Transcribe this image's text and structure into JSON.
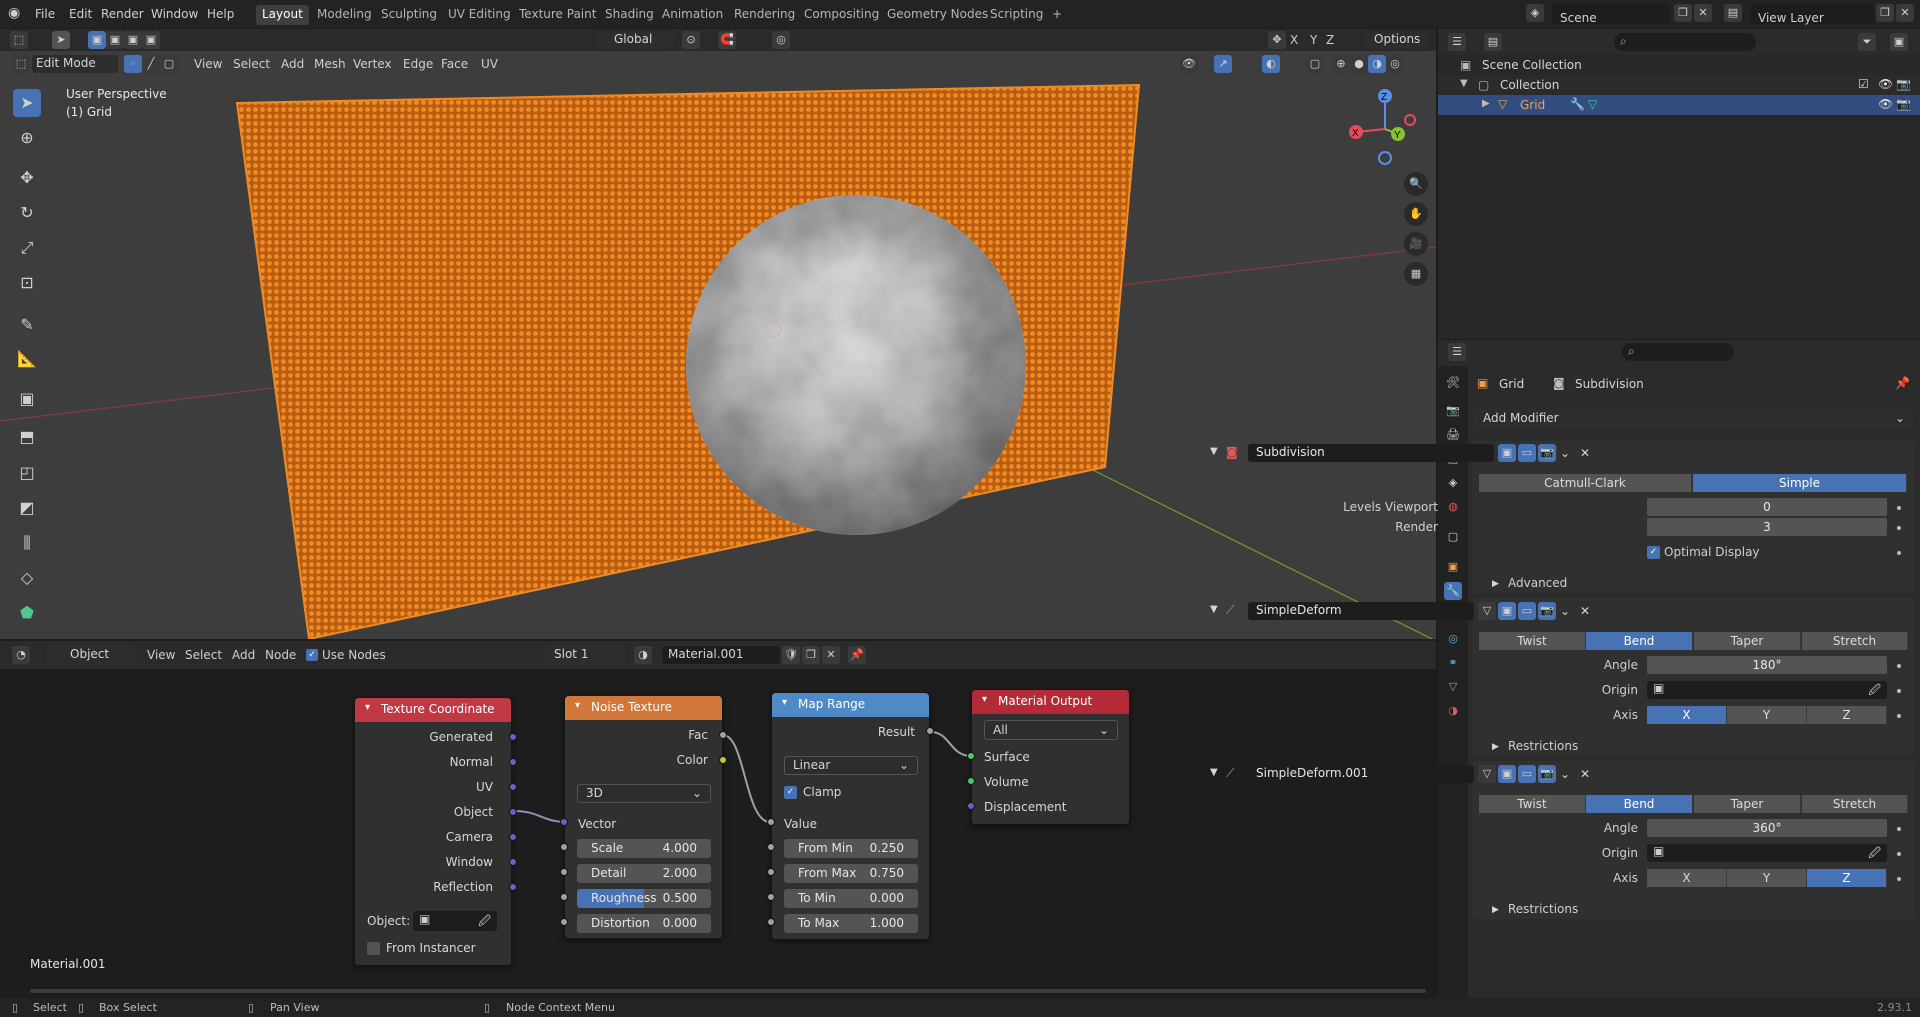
{
  "topbar": {
    "menus": [
      "File",
      "Edit",
      "Render",
      "Window",
      "Help"
    ],
    "workspaces": [
      "Layout",
      "Modeling",
      "Sculpting",
      "UV Editing",
      "Texture Paint",
      "Shading",
      "Animation",
      "Rendering",
      "Compositing",
      "Geometry Nodes",
      "Scripting"
    ],
    "active_workspace": "Layout",
    "add_tab": "+",
    "scene": "Scene",
    "view_layer": "View Layer"
  },
  "viewport": {
    "mode": "Edit Mode",
    "menus": [
      "View",
      "Select",
      "Add",
      "Mesh",
      "Vertex",
      "Edge",
      "Face",
      "UV"
    ],
    "orientation": "Global",
    "options": "Options",
    "overlay_title": "User Perspective",
    "overlay_object": "(1) Grid",
    "axes": [
      "X",
      "Y",
      "Z"
    ],
    "gizmo": {
      "x": "X",
      "y": "Y",
      "z": "Z"
    }
  },
  "node_editor": {
    "object_type": "Object",
    "menus": [
      "View",
      "Select",
      "Add",
      "Node"
    ],
    "use_nodes_label": "Use Nodes",
    "slot": "Slot 1",
    "material": "Material.001",
    "footer_label": "Material.001",
    "texture_coordinate": {
      "title": "Texture Coordinate",
      "outputs": [
        "Generated",
        "Normal",
        "UV",
        "Object",
        "Camera",
        "Window",
        "Reflection"
      ],
      "object_label": "Object:",
      "from_instancer": "From Instancer"
    },
    "noise_texture": {
      "title": "Noise Texture",
      "outputs": [
        "Fac",
        "Color"
      ],
      "dimension": "3D",
      "vector": "Vector",
      "fields": [
        {
          "label": "Scale",
          "value": "4.000"
        },
        {
          "label": "Detail",
          "value": "2.000"
        },
        {
          "label": "Roughness",
          "value": "0.500"
        },
        {
          "label": "Distortion",
          "value": "0.000"
        }
      ]
    },
    "map_range": {
      "title": "Map Range",
      "output": "Result",
      "interpolation": "Linear",
      "clamp": "Clamp",
      "value": "Value",
      "fields": [
        {
          "label": "From Min",
          "value": "0.250"
        },
        {
          "label": "From Max",
          "value": "0.750"
        },
        {
          "label": "To Min",
          "value": "0.000"
        },
        {
          "label": "To Max",
          "value": "1.000"
        }
      ]
    },
    "material_output": {
      "title": "Material Output",
      "target": "All",
      "inputs": [
        "Surface",
        "Volume",
        "Displacement"
      ]
    }
  },
  "outliner": {
    "scene_collection": "Scene Collection",
    "collection": "Collection",
    "object": "Grid"
  },
  "properties": {
    "object": "Grid",
    "modifier_context": "Subdivision",
    "add_modifier": "Add Modifier",
    "subdivision": {
      "name": "Subdivision",
      "types": [
        "Catmull-Clark",
        "Simple"
      ],
      "active_type": "Simple",
      "levels_viewport_label": "Levels Viewport",
      "levels_viewport": "0",
      "render_label": "Render",
      "render": "3",
      "optimal_display": "Optimal Display",
      "advanced": "Advanced"
    },
    "simple_deform_1": {
      "name": "SimpleDeform",
      "modes": [
        "Twist",
        "Bend",
        "Taper",
        "Stretch"
      ],
      "active_mode": "Bend",
      "angle_label": "Angle",
      "angle": "180°",
      "origin_label": "Origin",
      "axis_label": "Axis",
      "axes": [
        "X",
        "Y",
        "Z"
      ],
      "active_axis": "X",
      "restrictions": "Restrictions"
    },
    "simple_deform_2": {
      "name": "SimpleDeform.001",
      "modes": [
        "Twist",
        "Bend",
        "Taper",
        "Stretch"
      ],
      "active_mode": "Bend",
      "angle_label": "Angle",
      "angle": "360°",
      "origin_label": "Origin",
      "axis_label": "Axis",
      "axes": [
        "X",
        "Y",
        "Z"
      ],
      "active_axis": "Z",
      "restrictions": "Restrictions"
    }
  },
  "statusbar": {
    "select": "Select",
    "box_select": "Box Select",
    "pan_view": "Pan View",
    "node_context_menu": "Node Context Menu",
    "version": "2.93.1"
  },
  "colors": {
    "accent": "#4772b3",
    "grid_orange": "#e87a1b",
    "texcoord_header": "#c13845",
    "noise_header": "#d2773a",
    "maprange_header": "#4f8ac6",
    "output_header": "#b42a37"
  }
}
